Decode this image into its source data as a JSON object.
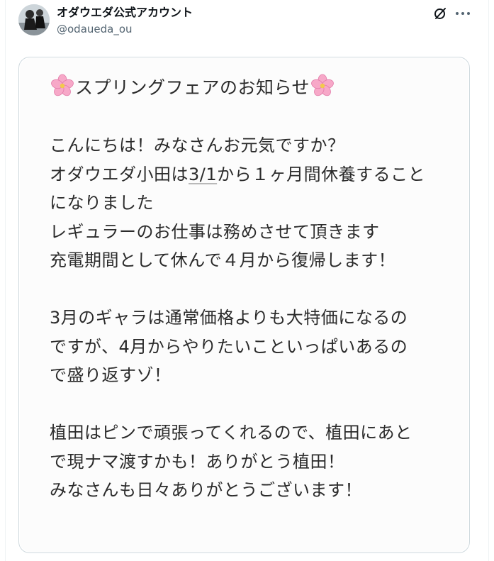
{
  "post": {
    "display_name": "オダウエダ公式アカウント",
    "handle": "@odaueda_ou",
    "icons": {
      "grok": "grok-icon",
      "more": "more-icon",
      "flower": "cherry-blossom-icon"
    },
    "accent_color": "#f5a3c7"
  },
  "notice": {
    "title": "スプリングフェアのお知らせ",
    "lines": {
      "l1": "こんにちは！みなさんお元気ですか？",
      "l2_before": "オダウエダ小田は",
      "l2_date": "3/1",
      "l2_after": "から１ヶ月間休養すること",
      "l3": "になりました",
      "l4": "レギュラーのお仕事は務めさせて頂きます",
      "l5": "充電期間として休んで４月から復帰します！",
      "l6": "3月のギャラは通常価格よりも大特価になるの",
      "l7": "ですが、4月からやりたいこといっぱいあるの",
      "l8": "で盛り返すゾ！",
      "l9": "植田はピンで頑張ってくれるので、植田にあと",
      "l10": "で現ナマ渡すかも！ありがとう植田！",
      "l11": "みなさんも日々ありがとうございます！"
    }
  }
}
